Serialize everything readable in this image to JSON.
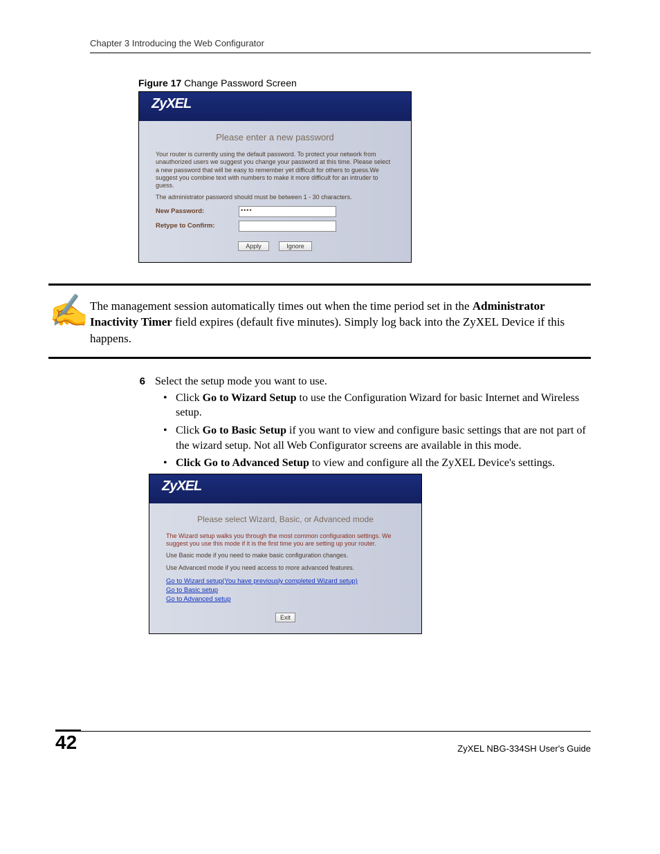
{
  "header": {
    "chapter": "Chapter 3 Introducing the Web Configurator"
  },
  "figure17": {
    "label_strong": "Figure 17",
    "label_rest": "   Change Password Screen"
  },
  "screenshot1": {
    "logo": "ZyXEL",
    "heading": "Please enter a new password",
    "para1": "Your router is currently using the default password. To protect your network from unauthorized users we suggest you change your password at this time. Please select a new password that will be easy to remember yet difficult for others to guess.We suggest you combine text with numbers to make it more difficult for an intruder to guess.",
    "para2": "The administrator password should must be between 1 - 30 characters.",
    "new_password_label": "New Password:",
    "new_password_value": "••••",
    "retype_label": "Retype to Confirm:",
    "retype_value": "",
    "btn_apply": "Apply",
    "btn_ignore": "Ignore"
  },
  "note": {
    "text_pre": "The management session automatically times out when the time period set in the ",
    "text_bold": "Administrator Inactivity Timer",
    "text_post": " field expires (default five minutes). Simply log back into the ZyXEL Device if this happens."
  },
  "step6": {
    "num": "6",
    "text": "Select the setup mode you want to use.",
    "bullets": [
      {
        "pre": "Click ",
        "bold": "Go to Wizard Setup",
        "post": " to use the Configuration Wizard for basic Internet and Wireless setup."
      },
      {
        "pre": "Click ",
        "bold": "Go to Basic Setup",
        "post": " if you want to view and configure basic settings that are not part of the wizard setup. Not all Web Configurator screens are available in this mode."
      },
      {
        "pre": "",
        "bold": "Click Go to Advanced Setup",
        "post": " to view and configure all the ZyXEL Device's settings."
      }
    ]
  },
  "screenshot2": {
    "logo": "ZyXEL",
    "heading": "Please select Wizard, Basic, or Advanced mode",
    "para1": "The Wizard setup walks you through the most common configuration settings. We suggest you use this mode if it is the first time you are setting up your router.",
    "para2": "Use Basic mode if you need to make basic configuration changes.",
    "para3": "Use Advanced mode if you need access to more advanced features.",
    "link_wizard": "Go to Wizard setup(You have previously completed Wizard setup)",
    "link_basic": "Go to Basic setup",
    "link_advanced": "Go to Advanced setup",
    "btn_exit": "Exit"
  },
  "footer": {
    "page": "42",
    "guide": "ZyXEL NBG-334SH User's Guide"
  }
}
